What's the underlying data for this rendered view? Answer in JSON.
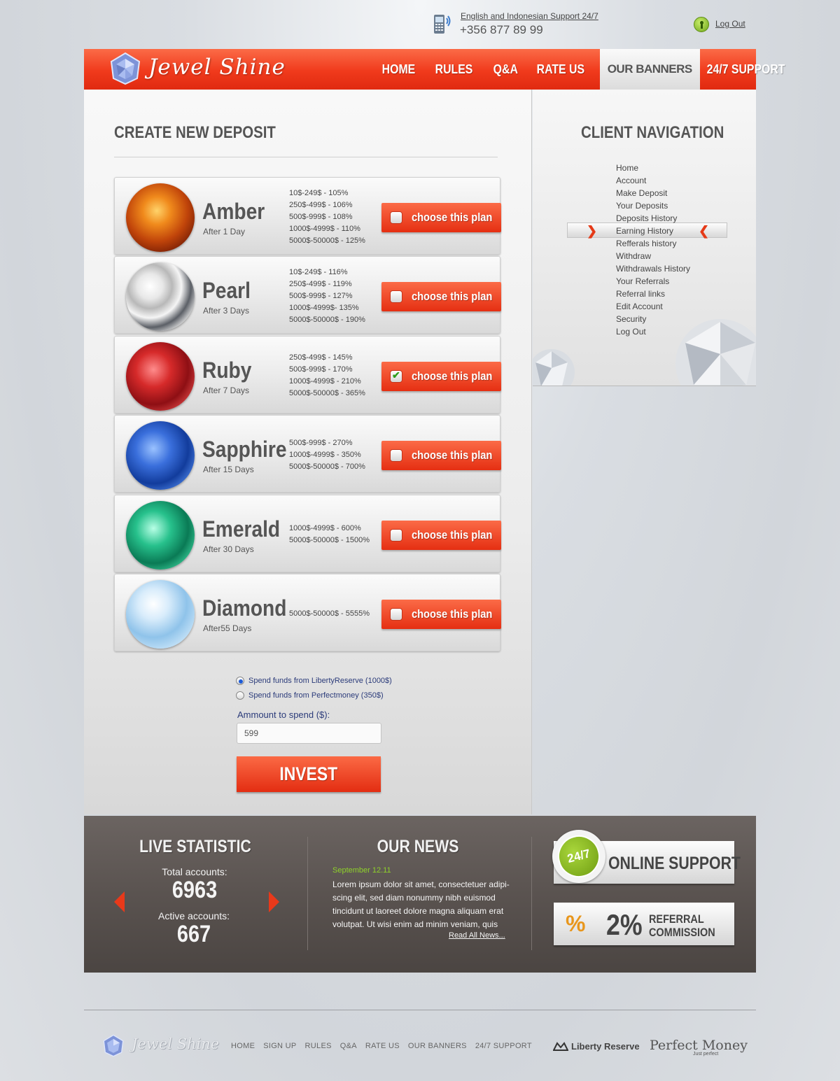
{
  "topbar": {
    "support_line": "English and Indonesian Support 24/7",
    "phone": "+356 877 89 99",
    "logout": "Log Out"
  },
  "brand": {
    "name": "Jewel Shine"
  },
  "nav": {
    "items": [
      {
        "label": "HOME",
        "active": false
      },
      {
        "label": "RULES",
        "active": false
      },
      {
        "label": "Q&A",
        "active": false
      },
      {
        "label": "RATE US",
        "active": false
      },
      {
        "label": "OUR BANNERS",
        "active": true
      },
      {
        "label": "24/7 SUPPORT",
        "active": false
      }
    ]
  },
  "deposit": {
    "title": "CREATE NEW DEPOSIT",
    "choose_label": "choose this plan",
    "plans": [
      {
        "name": "Amber",
        "term": "After 1 Day",
        "selected": false,
        "rates": [
          "10$-249$ - 105%",
          "250$-499$ - 106%",
          "500$-999$ - 108%",
          "1000$-4999$ - 110%",
          "5000$-50000$ - 125%"
        ]
      },
      {
        "name": "Pearl",
        "term": "After 3 Days",
        "selected": false,
        "rates": [
          "10$-249$ - 116%",
          "250$-499$ - 119%",
          "500$-999$ - 127%",
          "1000$-4999$- 135%",
          "5000$-50000$ - 190%"
        ]
      },
      {
        "name": "Ruby",
        "term": "After 7 Days",
        "selected": true,
        "rates": [
          "250$-499$ - 145%",
          "500$-999$ - 170%",
          "1000$-4999$ - 210%",
          "5000$-50000$ - 365%"
        ]
      },
      {
        "name": "Sapphire",
        "term": "After 15 Days",
        "selected": false,
        "rates": [
          "500$-999$ - 270%",
          "1000$-4999$ - 350%",
          "5000$-50000$ - 700%"
        ]
      },
      {
        "name": "Emerald",
        "term": "After 30 Days",
        "selected": false,
        "rates": [
          "1000$-4999$ - 600%",
          "5000$-50000$ - 1500%"
        ]
      },
      {
        "name": "Diamond",
        "term": "After55 Days",
        "selected": false,
        "rates": [
          "5000$-50000$ - 5555%"
        ]
      }
    ],
    "funding": [
      {
        "label": "Spend funds from LibertyReserve (1000$)",
        "checked": true
      },
      {
        "label": "Spend funds from Perfectmoney (350$)",
        "checked": false
      }
    ],
    "amount_label": "Ammount to spend ($):",
    "amount_value": "599",
    "invest_label": "INVEST"
  },
  "sidebar": {
    "title": "CLIENT NAVIGATION",
    "items": [
      "Home",
      "Account",
      "Make Deposit",
      "Your Deposits",
      "Deposits History",
      "Earning History",
      "Refferals history",
      "Withdraw",
      "Withdrawals History",
      "Your Referrals",
      "Referral links",
      "Edit Account",
      "Security",
      "Log Out"
    ],
    "active_item": "Earning History"
  },
  "stats": {
    "title": "LIVE STATISTIC",
    "total_label": "Total accounts:",
    "total_value": "6963",
    "active_label": "Active accounts:",
    "active_value": "667"
  },
  "news": {
    "title": "OUR NEWS",
    "date": "September 12.11",
    "body": "Lorem ipsum dolor sit amet, consectetuer adipi-scing elit, sed diam nonummy nibh euismod tincidunt ut laoreet dolore magna aliquam erat volutpat. Ut wisi enim ad minim veniam, quis",
    "more": "Read All News..."
  },
  "promo": {
    "badge": "24/7",
    "online": "ONLINE SUPPORT",
    "pct_symbol": "%",
    "referral_value": "2%",
    "referral_line1": "REFERRAL",
    "referral_line2": "COMMISSION"
  },
  "footer": {
    "links": [
      "HOME",
      "SIGN UP",
      "RULES",
      "Q&A",
      "RATE US",
      "OUR BANNERS",
      "24/7 SUPPORT"
    ],
    "liberty": "Liberty Reserve",
    "perfect": "Perfect Money",
    "perfect_sub": "Just perfect"
  },
  "colors": {
    "accent": "#f03a1c",
    "dark_panel": "#5a5350",
    "news_date": "#8fd22a"
  }
}
